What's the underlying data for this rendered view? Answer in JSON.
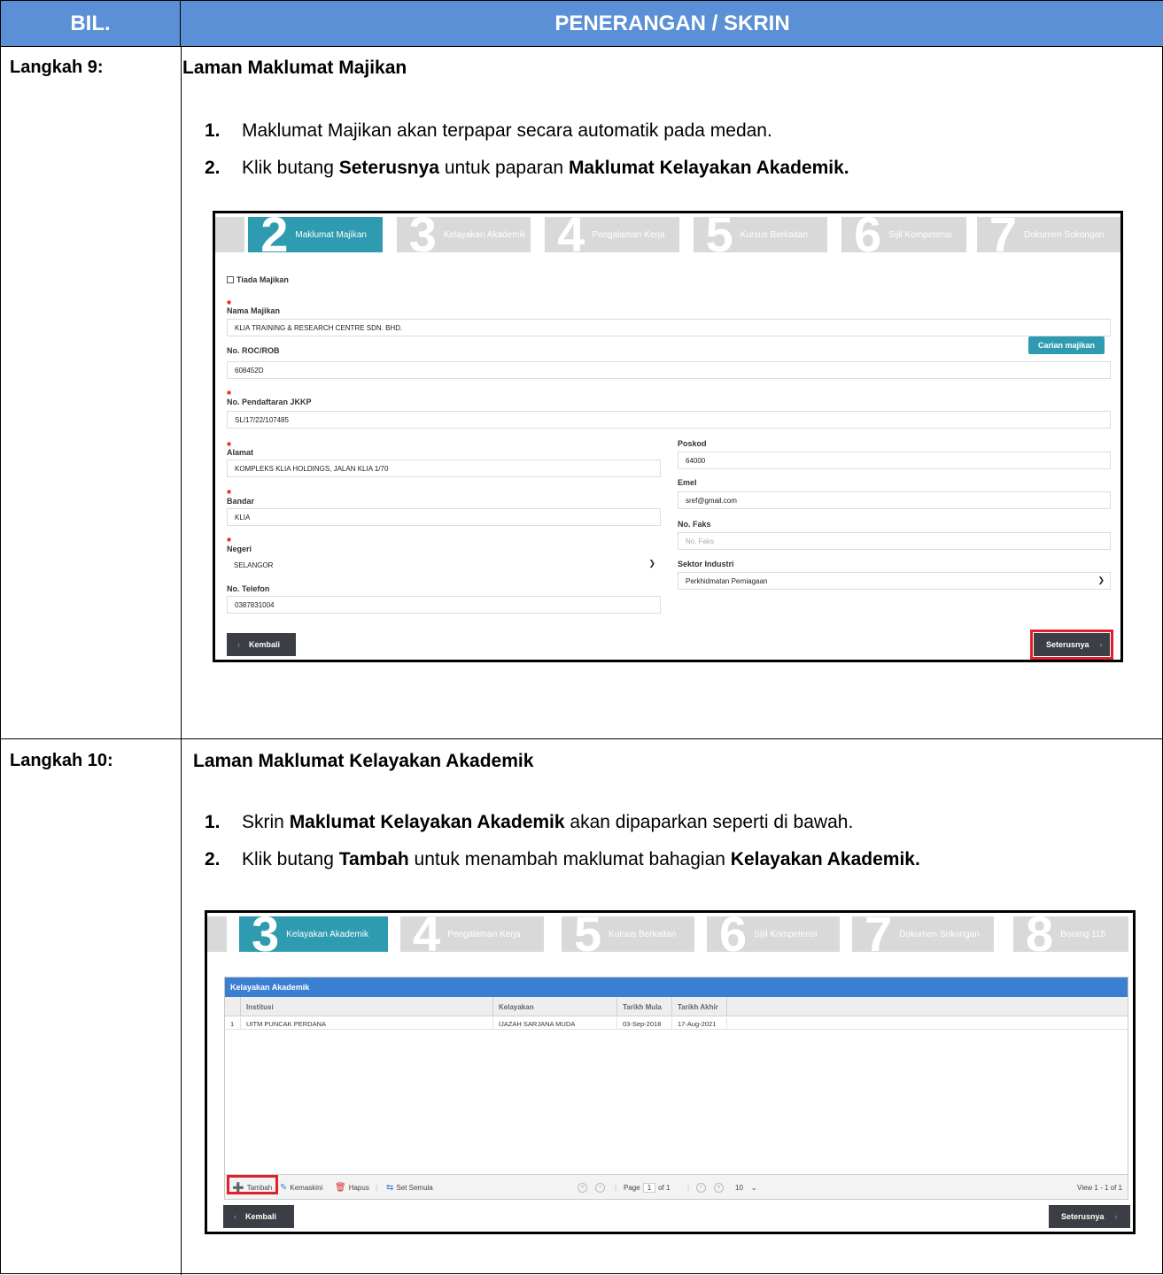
{
  "header": {
    "col1": "BIL.",
    "col2": "PENERANGAN / SKRIN"
  },
  "step9": {
    "label": "Langkah 9:",
    "title": "Laman Maklumat Majikan",
    "instructions": [
      {
        "num": "1.",
        "pre": "Maklumat Majikan akan terpapar secara automatik pada medan.",
        "bold": "",
        "mid": "",
        "bold2": ""
      },
      {
        "num": "2.",
        "pre": "Klik butang ",
        "bold": "Seterusnya",
        "mid": " untuk paparan ",
        "bold2": "Maklumat Kelayakan Akademik."
      }
    ],
    "screen": {
      "wizard": [
        {
          "num": "2",
          "label": "Maklumat Majikan",
          "active": true
        },
        {
          "num": "3",
          "label": "Kelayakan Akademik",
          "active": false
        },
        {
          "num": "4",
          "label": "Pengalaman Kerja",
          "active": false
        },
        {
          "num": "5",
          "label": "Kursus Berkaitan",
          "active": false
        },
        {
          "num": "6",
          "label": "Sijil Kompetensi",
          "active": false
        },
        {
          "num": "7",
          "label": "Dokumen Sokongan",
          "active": false
        }
      ],
      "no_employer": "Tiada Majikan",
      "fields": {
        "nama_label": "Nama Majikan",
        "nama_value": "KLIA TRAINING & RESEARCH CENTRE SDN. BHD.",
        "roc_label": "No. ROC/ROB",
        "roc_value": "608452D",
        "jkkp_label": "No. Pendaftaran JKKP",
        "jkkp_value": "SL/17/22/107485",
        "alamat_label": "Alamat",
        "alamat_value": "KOMPLEKS KLIA HOLDINGS, JALAN KLIA 1/70",
        "bandar_label": "Bandar",
        "bandar_value": "KLIA",
        "negeri_label": "Negeri",
        "negeri_value": "SELANGOR",
        "telefon_label": "No. Telefon",
        "telefon_value": "0387831004",
        "poskod_label": "Poskod",
        "poskod_value": "64000",
        "emel_label": "Emel",
        "emel_value": "sref@gmail.com",
        "faks_label": "No. Faks",
        "faks_placeholder": "No. Faks",
        "sektor_label": "Sektor Industri",
        "sektor_value": "Perkhidmatan Perniagaan"
      },
      "search_button": "Carian majikan",
      "back_button": "Kembali",
      "next_button": "Seterusnya"
    }
  },
  "step10": {
    "label": "Langkah 10:",
    "title": "Laman Maklumat Kelayakan Akademik",
    "instructions": [
      {
        "num": "1.",
        "pre": "Skrin ",
        "bold": "Maklumat Kelayakan Akademik",
        "mid": " akan dipaparkan seperti di bawah.",
        "bold2": ""
      },
      {
        "num": "2.",
        "pre": "Klik butang ",
        "bold": "Tambah",
        "mid": " untuk menambah maklumat bahagian ",
        "bold2": "Kelayakan Akademik."
      }
    ],
    "screen": {
      "wizard": [
        {
          "num": "3",
          "label": "Kelayakan Akademik",
          "active": true
        },
        {
          "num": "4",
          "label": "Pengalaman Kerja",
          "active": false
        },
        {
          "num": "5",
          "label": "Kursus Berkaitan",
          "active": false
        },
        {
          "num": "6",
          "label": "Sijil Kompetensi",
          "active": false
        },
        {
          "num": "7",
          "label": "Dokumen Sokongan",
          "active": false
        },
        {
          "num": "8",
          "label": "Borang 115",
          "active": false
        }
      ],
      "grid_caption": "Kelayakan Akademik",
      "columns": [
        "Institusi",
        "Kelayakan",
        "Tarikh Mula",
        "Tarikh Akhir"
      ],
      "rows": [
        {
          "no": "1",
          "institusi": "UITM PUNCAK PERDANA",
          "kelayakan": "IJAZAH SARJANA MUDA",
          "mula": "03-Sep-2018",
          "akhir": "17-Aug-2021"
        }
      ],
      "toolbar": {
        "add": "Tambah",
        "edit": "Kemaskini",
        "delete": "Hapus",
        "reset": "Set Semula"
      },
      "pager": {
        "page_label": "Page",
        "page": "1",
        "of": "of 1",
        "per_page": "10",
        "view": "View 1 - 1 of 1"
      },
      "back_button": "Kembali",
      "next_button": "Seterusnya"
    }
  }
}
